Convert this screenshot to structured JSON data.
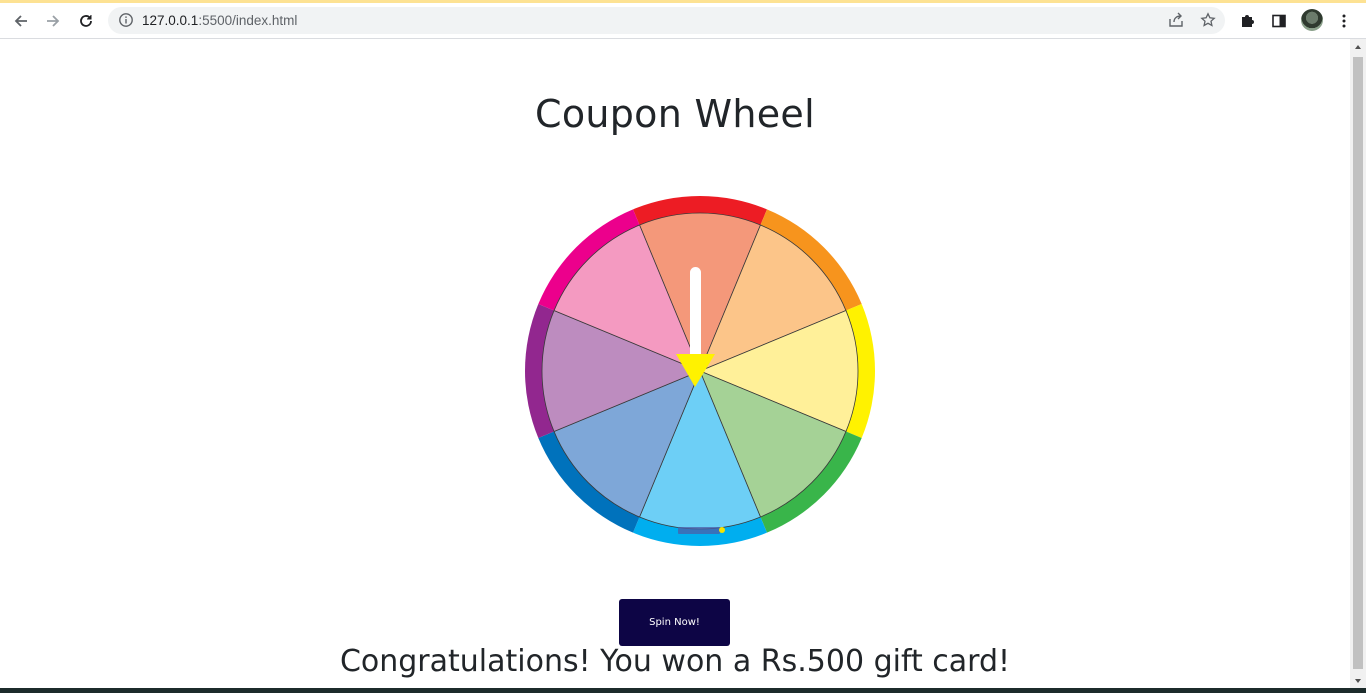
{
  "browser": {
    "url_host": "127.0.0.1",
    "url_rest": ":5500/index.html",
    "icons": {
      "back": "back-arrow-icon",
      "forward": "forward-arrow-icon",
      "reload": "reload-icon",
      "info": "site-info-icon",
      "share": "share-icon",
      "bookmark": "star-icon",
      "extensions": "puzzle-icon",
      "side_panel": "side-panel-icon",
      "menu": "kebab-menu-icon"
    }
  },
  "page": {
    "title": "Coupon Wheel",
    "spin_button_label": "Spin Now!",
    "result_message": "Congratulations! You won a Rs.500 gift card!"
  },
  "wheel": {
    "segment_count": 8,
    "segments": [
      {
        "inner": "#f4987a",
        "rim": "#ed1c24"
      },
      {
        "inner": "#fcc589",
        "rim": "#f7941d"
      },
      {
        "inner": "#fff099",
        "rim": "#fff200"
      },
      {
        "inner": "#a5d296",
        "rim": "#39b54a"
      },
      {
        "inner": "#6dcff6",
        "rim": "#00aeef"
      },
      {
        "inner": "#7ea7d8",
        "rim": "#0072bc"
      },
      {
        "inner": "#bd8cbf",
        "rim": "#92278f"
      },
      {
        "inner": "#f49ac1",
        "rim": "#ec008c"
      }
    ],
    "pointer_color": "#fff200",
    "needle_color": "#ffffff"
  },
  "colors": {
    "button_bg": "#0d0545",
    "text": "#212529"
  }
}
